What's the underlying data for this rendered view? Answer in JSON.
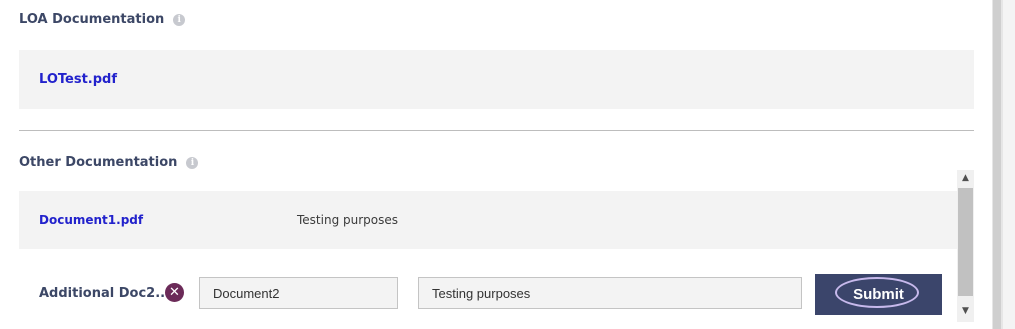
{
  "loa_section": {
    "title": "LOA Documentation",
    "info_icon": "info-icon",
    "file_link": "LOTest.pdf"
  },
  "other_section": {
    "title": "Other Documentation",
    "info_icon": "info-icon",
    "documents": [
      {
        "name": "Document1.pdf",
        "description": "Testing purposes"
      }
    ],
    "additional_form": {
      "label": "Additional Doc2...",
      "remove_icon": "close-circle-icon",
      "name_value": "Document2",
      "description_value": "Testing purposes",
      "submit_label": "Submit"
    }
  },
  "scrollbar": {
    "up_icon": "chevron-up-icon",
    "down_icon": "chevron-down-icon"
  },
  "colors": {
    "heading": "#3c4766",
    "link": "#2222cc",
    "panel": "#f3f3f3",
    "submit_bg": "#3b456b",
    "focus_ring": "#c7b9ec",
    "remove_icon": "#6b2a58"
  }
}
